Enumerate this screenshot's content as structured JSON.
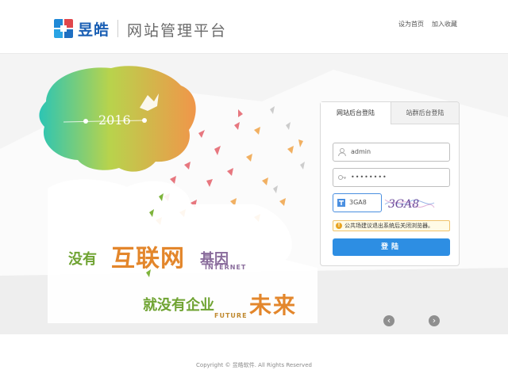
{
  "header": {
    "brand_name": "昱皓",
    "brand_subtitle": "网站管理平台",
    "links": {
      "home": "设为首页",
      "favorite": "加入收藏"
    }
  },
  "banner": {
    "year": "2016",
    "slogan_line1": {
      "part_a": "没有",
      "part_b": "互联网",
      "part_c": "基因",
      "english": "INTERNET"
    },
    "slogan_line2": {
      "part_a": "就没有企业",
      "part_b": "未来",
      "english": "FUTURE"
    },
    "prev_icon": "chevron-left-icon",
    "next_icon": "chevron-right-icon"
  },
  "login": {
    "tabs": [
      {
        "label": "网站后台登陆",
        "active": true
      },
      {
        "label": "站群后台登陆",
        "active": false
      }
    ],
    "username": {
      "value": "admin",
      "icon": "user-icon"
    },
    "password": {
      "value": "••••••••",
      "icon": "key-icon"
    },
    "captcha": {
      "value": "3GA8",
      "image_text": "3GA8",
      "icon": "text-icon"
    },
    "notice": "公共场建议退出系统后关闭浏览器。",
    "submit_label": "登陆",
    "accent_color": "#2d8ee3"
  },
  "footer": {
    "copyright": "Copyright © 昱皓软件. All Rights Reserved"
  }
}
